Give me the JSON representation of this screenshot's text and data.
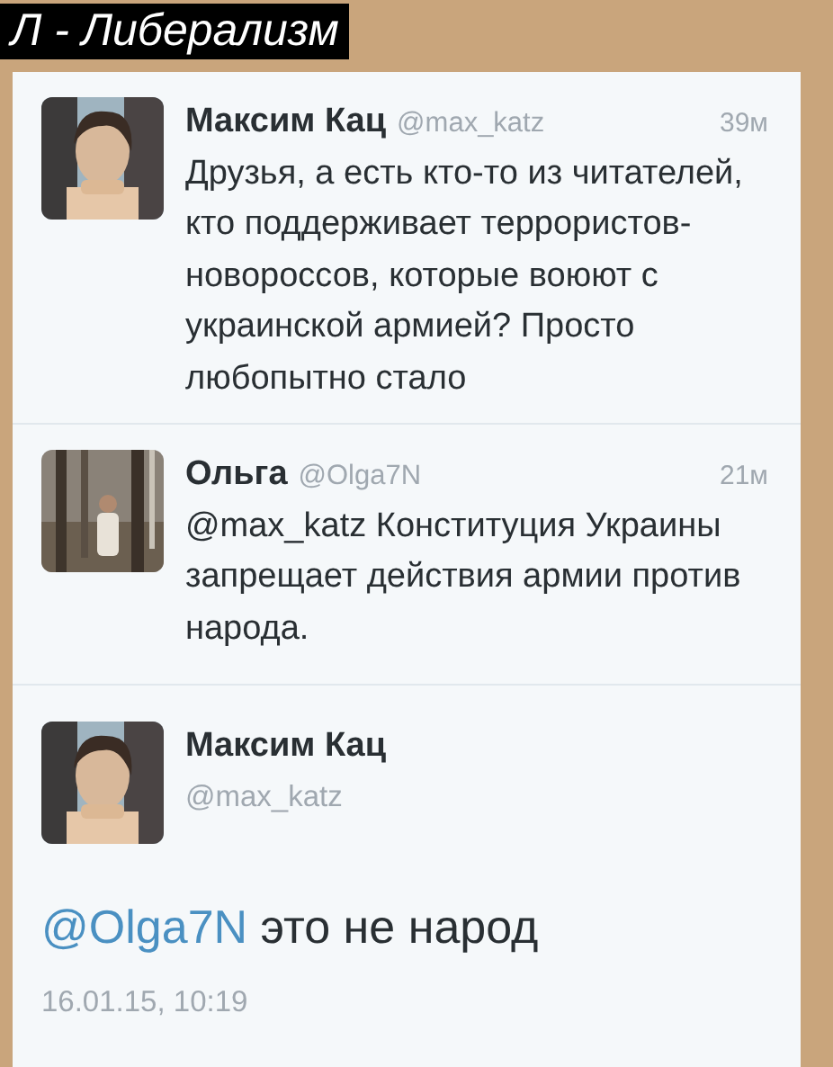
{
  "caption": "Л - Либерализм",
  "tweets": [
    {
      "name": "Максим Кац",
      "handle": "@max_katz",
      "time": "39м",
      "text": "Друзья, а есть кто-то из читателей, кто поддерживает террористов-новороссов, которые воюют с украинской армией? Просто любопытно стало"
    },
    {
      "name": "Ольга",
      "handle": "@Olga7N",
      "time": "21м",
      "text": "@max_katz Конституция Украины запрещает действия армии против народа."
    }
  ],
  "detail": {
    "name": "Максим Кац",
    "handle": "@max_katz",
    "mention": "@Olga7N",
    "text": "это не народ",
    "timestamp": "16.01.15, 10:19"
  }
}
